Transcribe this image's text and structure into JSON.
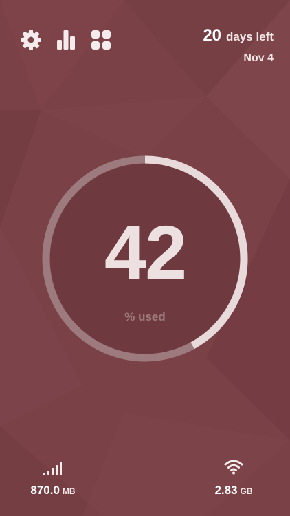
{
  "colors": {
    "background": "#7a4146",
    "background_facet_light": "#834a4f",
    "background_facet_dark": "#6f393e",
    "gauge_inner": "#6e3a3f",
    "ring_track": "#9d7a7d",
    "ring_fill": "#e8dadb",
    "value_text": "#ede0e1",
    "caption_text": "#9f7a7d",
    "icon": "#f4ecec"
  },
  "toolbar": {
    "settings_icon": "gear-icon",
    "history_icon": "bar-chart-icon",
    "apps_icon": "grid-icon"
  },
  "cycle": {
    "days_left_number": "20",
    "days_left_label": "days left",
    "end_date": "Nov 4"
  },
  "usage": {
    "percent_used": 42,
    "value_text": "42",
    "caption": "% used"
  },
  "cellular": {
    "icon": "cellular-signal-icon",
    "value": "870.0",
    "unit": "MB"
  },
  "wifi": {
    "icon": "wifi-icon",
    "value": "2.83",
    "unit": "GB"
  }
}
